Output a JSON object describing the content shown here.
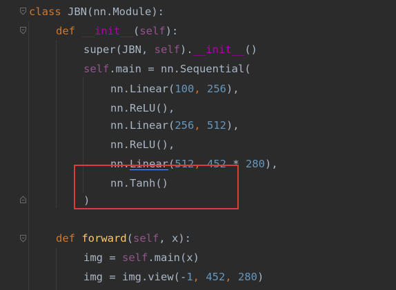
{
  "editor": {
    "lines": [
      {
        "parts": [
          {
            "t": "class ",
            "c": "kw"
          },
          {
            "t": "JBN(nn.Module):",
            "c": "plain"
          }
        ]
      },
      {
        "parts": [
          {
            "t": "def ",
            "c": "kw"
          },
          {
            "t": "__init__",
            "c": "dunder"
          },
          {
            "t": "(",
            "c": "plain"
          },
          {
            "t": "self",
            "c": "self"
          },
          {
            "t": "):",
            "c": "plain"
          }
        ]
      },
      {
        "parts": [
          {
            "t": "super",
            "c": "plain"
          },
          {
            "t": "(JBN, ",
            "c": "plain"
          },
          {
            "t": "self",
            "c": "self"
          },
          {
            "t": ").",
            "c": "plain"
          },
          {
            "t": "__init__",
            "c": "dunder"
          },
          {
            "t": "()",
            "c": "plain"
          }
        ]
      },
      {
        "parts": [
          {
            "t": "self",
            "c": "self"
          },
          {
            "t": ".main = nn.Sequential(",
            "c": "plain"
          }
        ]
      },
      {
        "parts": [
          {
            "t": "nn.Linear(",
            "c": "plain"
          },
          {
            "t": "100",
            "c": "num"
          },
          {
            "t": ", ",
            "c": "kw"
          },
          {
            "t": "256",
            "c": "num"
          },
          {
            "t": "),",
            "c": "plain"
          }
        ]
      },
      {
        "parts": [
          {
            "t": "nn.ReLU(),",
            "c": "plain"
          }
        ]
      },
      {
        "parts": [
          {
            "t": "nn.Linear(",
            "c": "plain"
          },
          {
            "t": "256",
            "c": "num"
          },
          {
            "t": ", ",
            "c": "kw"
          },
          {
            "t": "512",
            "c": "num"
          },
          {
            "t": "),",
            "c": "plain"
          }
        ]
      },
      {
        "parts": [
          {
            "t": "nn.ReLU(),",
            "c": "plain"
          }
        ]
      },
      {
        "parts": [
          {
            "t": "nn.",
            "c": "plain"
          },
          {
            "t": "Linear",
            "c": "plain",
            "u": true
          },
          {
            "t": "(",
            "c": "plain"
          },
          {
            "t": "512",
            "c": "num"
          },
          {
            "t": ", ",
            "c": "kw"
          },
          {
            "t": "452",
            "c": "num"
          },
          {
            "t": " * ",
            "c": "plain"
          },
          {
            "t": "280",
            "c": "num"
          },
          {
            "t": "),",
            "c": "plain"
          }
        ]
      },
      {
        "parts": [
          {
            "t": "nn.Tanh()",
            "c": "plain"
          }
        ]
      },
      {
        "parts": [
          {
            "t": ")",
            "c": "plain"
          }
        ]
      },
      {
        "parts": []
      },
      {
        "parts": [
          {
            "t": "def ",
            "c": "kw"
          },
          {
            "t": "forward",
            "c": "fn"
          },
          {
            "t": "(",
            "c": "plain"
          },
          {
            "t": "self",
            "c": "self"
          },
          {
            "t": ", x):",
            "c": "plain"
          }
        ]
      },
      {
        "parts": [
          {
            "t": "img = ",
            "c": "plain"
          },
          {
            "t": "self",
            "c": "self"
          },
          {
            "t": ".main(x)",
            "c": "plain"
          }
        ]
      },
      {
        "parts": [
          {
            "t": "img = img.view(-",
            "c": "plain"
          },
          {
            "t": "1",
            "c": "num"
          },
          {
            "t": ", ",
            "c": "kw"
          },
          {
            "t": "452",
            "c": "num"
          },
          {
            "t": ", ",
            "c": "kw"
          },
          {
            "t": "280",
            "c": "num"
          },
          {
            "t": ")",
            "c": "plain"
          }
        ]
      }
    ]
  }
}
